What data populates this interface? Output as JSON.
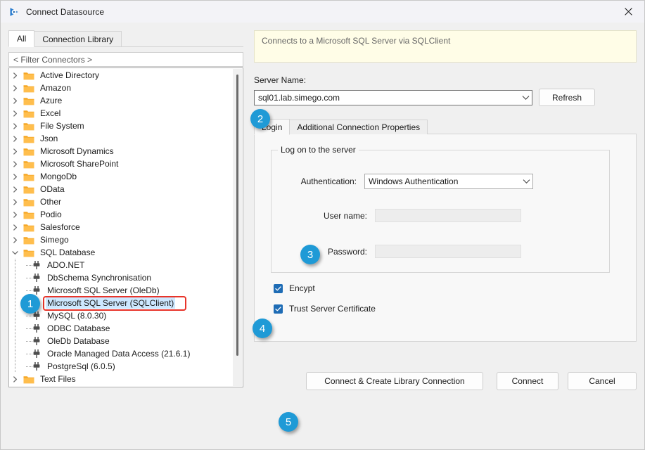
{
  "window": {
    "title": "Connect Datasource",
    "app_icon": "play-triangle-icon",
    "close_icon": "close-icon"
  },
  "left_pane": {
    "tabs": [
      {
        "label": "All",
        "active": true
      },
      {
        "label": "Connection Library",
        "active": false
      }
    ],
    "filter": {
      "placeholder": "< Filter Connectors >",
      "value": "< Filter Connectors >"
    },
    "tree": [
      {
        "label": "Active Directory",
        "type": "folder",
        "depth": 0,
        "expanded": false
      },
      {
        "label": "Amazon",
        "type": "folder",
        "depth": 0,
        "expanded": false
      },
      {
        "label": "Azure",
        "type": "folder",
        "depth": 0,
        "expanded": false
      },
      {
        "label": "Excel",
        "type": "folder",
        "depth": 0,
        "expanded": false
      },
      {
        "label": "File System",
        "type": "folder",
        "depth": 0,
        "expanded": false
      },
      {
        "label": "Json",
        "type": "folder",
        "depth": 0,
        "expanded": false
      },
      {
        "label": "Microsoft Dynamics",
        "type": "folder",
        "depth": 0,
        "expanded": false
      },
      {
        "label": "Microsoft SharePoint",
        "type": "folder",
        "depth": 0,
        "expanded": false
      },
      {
        "label": "MongoDb",
        "type": "folder",
        "depth": 0,
        "expanded": false
      },
      {
        "label": "OData",
        "type": "folder",
        "depth": 0,
        "expanded": false
      },
      {
        "label": "Other",
        "type": "folder",
        "depth": 0,
        "expanded": false
      },
      {
        "label": "Podio",
        "type": "folder",
        "depth": 0,
        "expanded": false
      },
      {
        "label": "Salesforce",
        "type": "folder",
        "depth": 0,
        "expanded": false
      },
      {
        "label": "Simego",
        "type": "folder",
        "depth": 0,
        "expanded": false
      },
      {
        "label": "SQL Database",
        "type": "folder",
        "depth": 0,
        "expanded": true
      },
      {
        "label": "ADO.NET",
        "type": "connector",
        "depth": 1,
        "selected": false
      },
      {
        "label": "DbSchema Synchronisation",
        "type": "connector",
        "depth": 1,
        "selected": false
      },
      {
        "label": "Microsoft SQL Server (OleDb)",
        "type": "connector",
        "depth": 1,
        "selected": false
      },
      {
        "label": "Microsoft SQL Server (SQLClient)",
        "type": "connector",
        "depth": 1,
        "selected": true
      },
      {
        "label": "MySQL (8.0.30)",
        "type": "connector",
        "depth": 1,
        "selected": false
      },
      {
        "label": "ODBC Database",
        "type": "connector",
        "depth": 1,
        "selected": false
      },
      {
        "label": "OleDb Database",
        "type": "connector",
        "depth": 1,
        "selected": false
      },
      {
        "label": "Oracle Managed Data Access (21.6.1)",
        "type": "connector",
        "depth": 1,
        "selected": false
      },
      {
        "label": "PostgreSql (6.0.5)",
        "type": "connector",
        "depth": 1,
        "selected": false
      },
      {
        "label": "Text Files",
        "type": "folder",
        "depth": 0,
        "expanded": false
      }
    ]
  },
  "right_pane": {
    "description": "Connects to a Microsoft SQL Server via SQLClient",
    "server_name_label": "Server Name:",
    "server_name_value": "sql01.lab.simego.com",
    "server_name_chevron": "chevron-down-icon",
    "refresh_label": "Refresh",
    "tabs": [
      {
        "label": "Login",
        "active": true
      },
      {
        "label": "Additional Connection Properties",
        "active": false
      }
    ],
    "group_title": "Log on to the server",
    "auth_label": "Authentication:",
    "auth_value": "Windows Authentication",
    "auth_chevron": "chevron-down-icon",
    "username_label": "User name:",
    "username_value": "",
    "password_label": "Password:",
    "password_value": "",
    "checkboxes": [
      {
        "label": "Encypt",
        "checked": true
      },
      {
        "label": "Trust Server Certificate",
        "checked": true
      }
    ]
  },
  "footer": {
    "connect_create_label": "Connect & Create Library Connection",
    "connect_label": "Connect",
    "cancel_label": "Cancel"
  },
  "annotations": {
    "badges": [
      "1",
      "2",
      "3",
      "4",
      "5"
    ],
    "highlight_color": "#e8342a",
    "badge_color": "#1f9ad6"
  }
}
